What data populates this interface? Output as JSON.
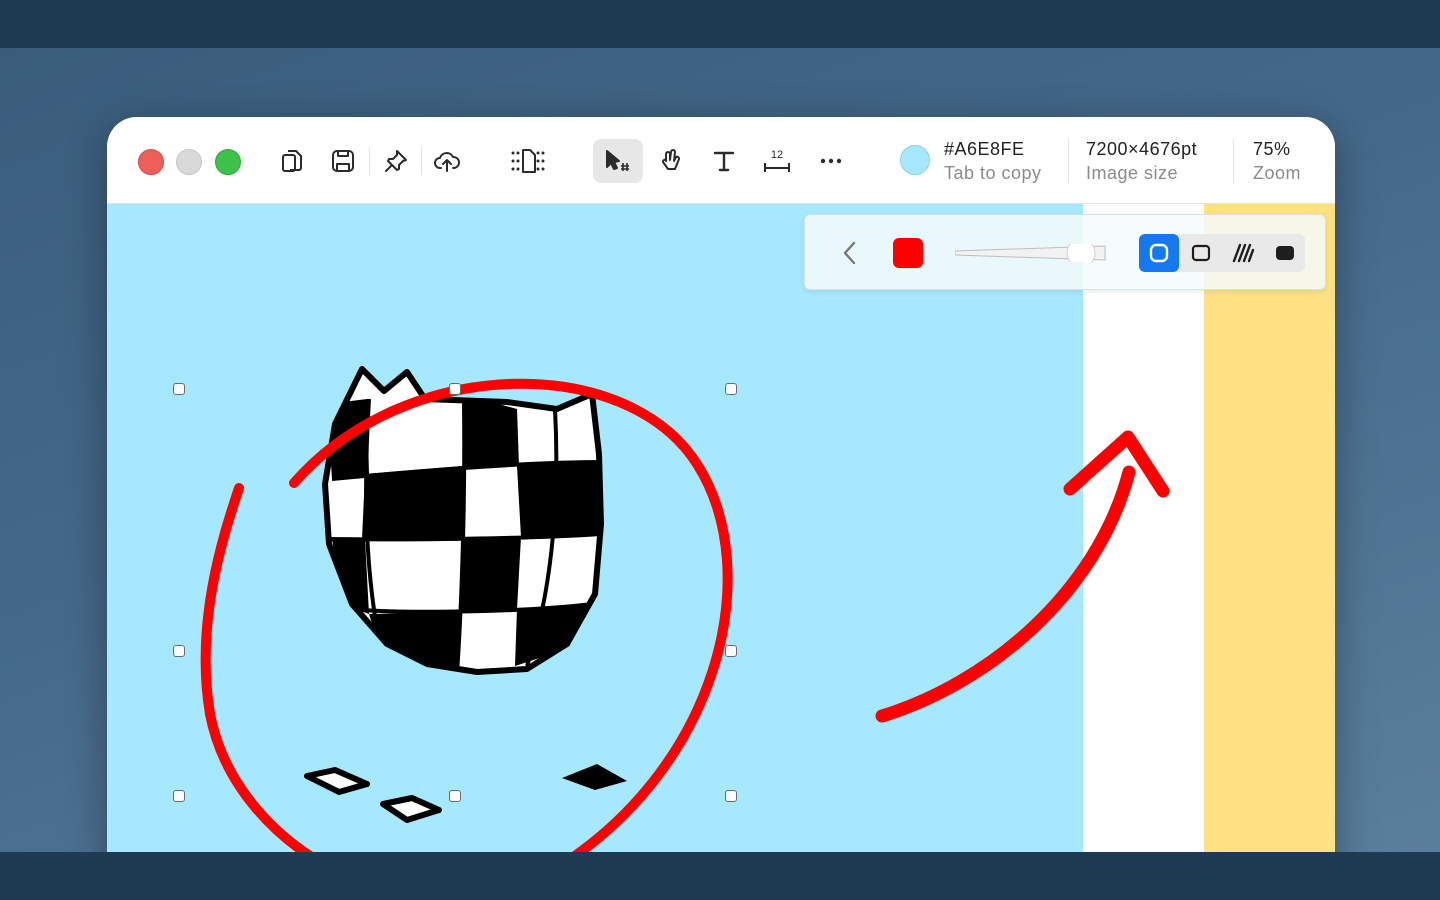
{
  "window": {
    "controls": [
      "close",
      "minimize",
      "zoom"
    ]
  },
  "toolbar": {
    "tools": [
      {
        "name": "copy-icon"
      },
      {
        "name": "save-icon"
      },
      {
        "name": "pin-icon"
      },
      {
        "name": "cloud-upload-icon"
      },
      {
        "name": "fit-page-icon"
      },
      {
        "name": "select-tool-icon",
        "active": true
      },
      {
        "name": "hand-pan-icon"
      },
      {
        "name": "text-tool-icon"
      },
      {
        "name": "measure-tool-icon",
        "label": "12"
      },
      {
        "name": "more-icon"
      }
    ],
    "color": {
      "value": "#A6E8FE",
      "hint": "Tab to copy",
      "swatch": "#A6E8FE"
    },
    "image_size": {
      "value": "7200×4676pt",
      "label": "Image size"
    },
    "zoom": {
      "value": "75%",
      "label": "Zoom"
    }
  },
  "annotation_bar": {
    "stroke_color": "#ff0000",
    "stroke_width_level": 0.82,
    "styles": [
      "outline-rounded",
      "outline-square",
      "hatched",
      "filled"
    ],
    "selected_style": "outline-rounded"
  },
  "colors": {
    "canvas_bg": "#A6E8FE",
    "accent": "#1479f0",
    "annotation": "#ff0000",
    "strip_yellow": "#fde183"
  }
}
